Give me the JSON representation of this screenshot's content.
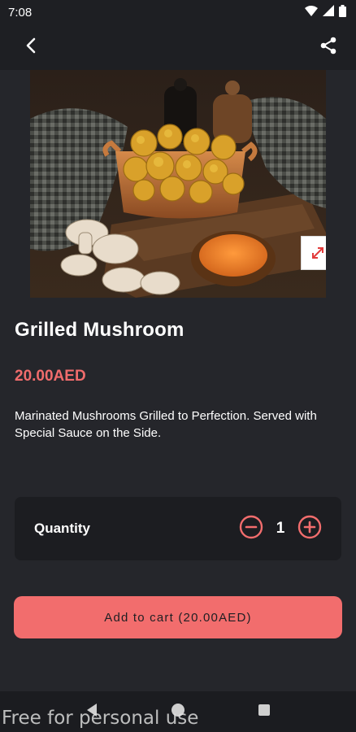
{
  "status_bar": {
    "time": "7:08",
    "icons": [
      "wifi-icon",
      "signal-icon",
      "battery-icon"
    ]
  },
  "toolbar": {
    "back_icon": "back-arrow-icon",
    "share_icon": "share-icon"
  },
  "product": {
    "image_alt": "grilled-mushroom-photo",
    "expand_icon": "expand-icon",
    "name": "Grilled Mushroom",
    "price": "20.00AED",
    "description": "Marinated Mushrooms Grilled to Perfection. Served with Special Sauce on the Side."
  },
  "quantity": {
    "label": "Quantity",
    "value": "1",
    "decrement_icon": "minus-circle-icon",
    "increment_icon": "plus-circle-icon"
  },
  "cart": {
    "add_label": "Add to cart (20.00AED)"
  },
  "nav_bar": {
    "icons": [
      "nav-back-icon",
      "nav-home-icon",
      "nav-recents-icon"
    ]
  },
  "watermark": "Free for personal use",
  "colors": {
    "background": "#25262b",
    "accent": "#f26d6d",
    "price": "#f06c6c",
    "card": "#1c1d21"
  }
}
